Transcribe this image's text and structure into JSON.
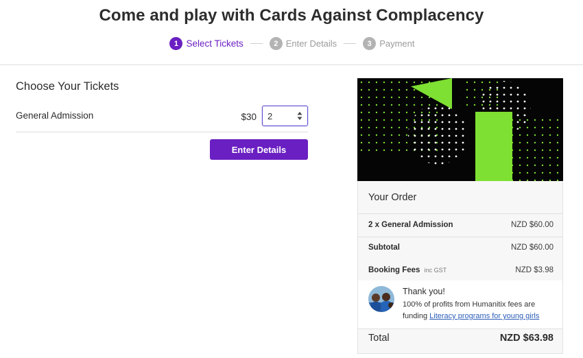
{
  "header": {
    "title": "Come and play with Cards Against Complacency",
    "steps": [
      {
        "num": "1",
        "label": "Select Tickets"
      },
      {
        "num": "2",
        "label": "Enter Details"
      },
      {
        "num": "3",
        "label": "Payment"
      }
    ]
  },
  "tickets": {
    "section_title": "Choose Your Tickets",
    "items": [
      {
        "name": "General Admission",
        "price": "$30",
        "quantity": "2"
      }
    ],
    "enter_button_label": "Enter Details"
  },
  "order": {
    "title": "Your Order",
    "line_item": {
      "label": "2 x General Admission",
      "value": "NZD $60.00"
    },
    "subtotal": {
      "label": "Subtotal",
      "value": "NZD $60.00"
    },
    "booking_fees": {
      "label": "Booking Fees",
      "note": "inc GST",
      "value": "NZD $3.98"
    },
    "thank_you": {
      "title": "Thank you!",
      "text": "100% of profits from Humanitix fees are funding",
      "link": "Literacy programs for young girls"
    },
    "total": {
      "label": "Total",
      "value": "NZD $63.98"
    }
  },
  "colors": {
    "accent": "#6a1fc2",
    "banner_green": "#7ee032",
    "banner_bg": "#050505"
  },
  "icons": {
    "qty_arrows": "up-down-arrows-icon"
  }
}
